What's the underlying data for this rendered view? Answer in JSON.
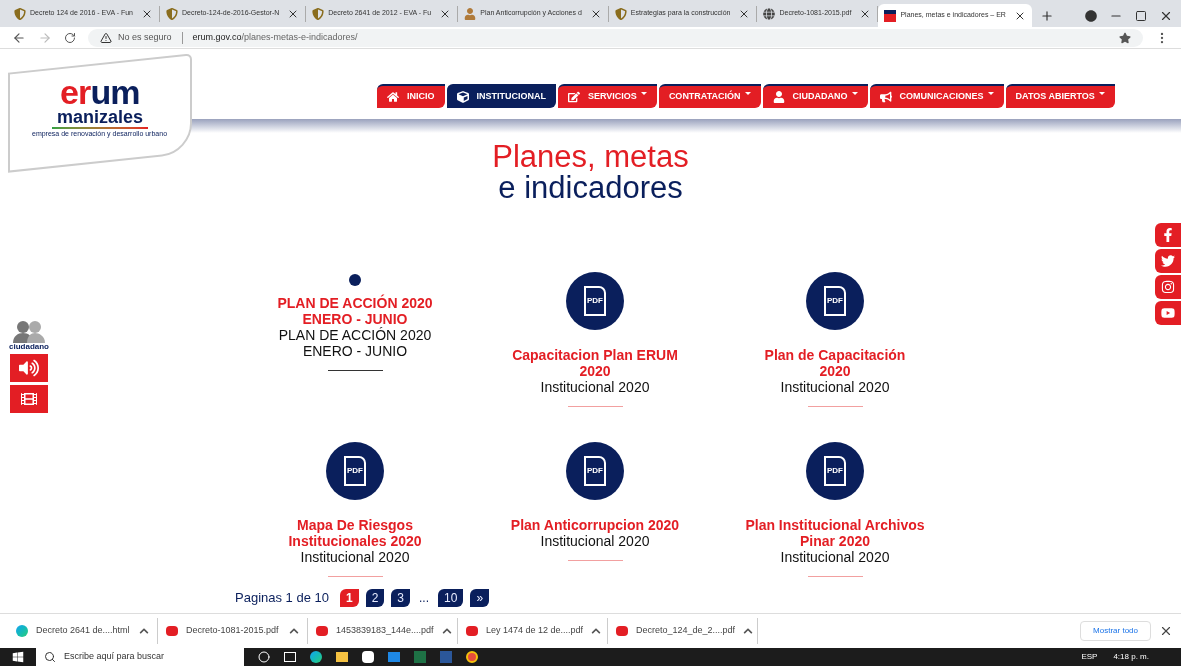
{
  "browser": {
    "tabs": [
      {
        "title": "Decreto 124 de 2016 - EVA - Fun",
        "selected": false
      },
      {
        "title": "Decreto-124-de-2016-Gestor-N",
        "selected": false
      },
      {
        "title": "Decreto 2641 de 2012 - EVA - Fu",
        "selected": false
      },
      {
        "title": "Plan Anticorrupción y Acciones d",
        "selected": false
      },
      {
        "title": "Estrategias para la construcción",
        "selected": false
      },
      {
        "title": "Decreto-1081-2015.pdf",
        "selected": false
      },
      {
        "title": "Planes, metas e indicadores – ER",
        "selected": true
      }
    ],
    "security": "No es seguro",
    "url_host": "erum.gov.co",
    "url_path": "/planes-metas-e-indicadores/"
  },
  "logo": {
    "brand_a": "er",
    "brand_b": "um",
    "city": "manizales",
    "tagline": "empresa de renovación y desarrollo urbano"
  },
  "menu": [
    {
      "label": "INICIO",
      "selected": false,
      "dropdown": false
    },
    {
      "label": "INSTITUCIONAL",
      "selected": true,
      "dropdown": false
    },
    {
      "label": "SERVICIOS",
      "selected": false,
      "dropdown": true
    },
    {
      "label": "CONTRATACIÓN",
      "selected": false,
      "dropdown": true
    },
    {
      "label": "CIUDADANO",
      "selected": false,
      "dropdown": true
    },
    {
      "label": "COMUNICACIONES",
      "selected": false,
      "dropdown": true
    },
    {
      "label": "DATOS ABIERTOS",
      "selected": false,
      "dropdown": true
    }
  ],
  "page_title": {
    "line_1": "Planes, metas",
    "line_2": "e indicadores"
  },
  "accessibility": {
    "label": "ciudadano"
  },
  "cards": [
    {
      "kind": "bullet",
      "title_lines": [
        "PLAN DE ACCIÓN 2020",
        "ENERO - JUNIO"
      ],
      "subtitle_lines": [
        "PLAN DE ACCIÓN 2020",
        "ENERO - JUNIO"
      ]
    },
    {
      "kind": "pdf",
      "icon_label": "PDF",
      "title_lines": [
        "Capacitacion Plan ERUM",
        "2020"
      ],
      "subtitle_lines": [
        "Institucional 2020"
      ]
    },
    {
      "kind": "pdf",
      "icon_label": "PDF",
      "title_lines": [
        "Plan de Capacitación",
        "2020"
      ],
      "subtitle_lines": [
        "Institucional 2020"
      ]
    },
    {
      "kind": "pdf",
      "icon_label": "PDF",
      "title_lines": [
        "Mapa De Riesgos",
        "Institucionales 2020"
      ],
      "subtitle_lines": [
        "Institucional 2020"
      ]
    },
    {
      "kind": "pdf",
      "icon_label": "PDF",
      "title_lines": [
        "Plan Anticorrupcion 2020"
      ],
      "subtitle_lines": [
        "Institucional 2020"
      ]
    },
    {
      "kind": "pdf",
      "icon_label": "PDF",
      "title_lines": [
        "Plan Institucional Archivos",
        "Pinar 2020"
      ],
      "subtitle_lines": [
        "Institucional 2020"
      ]
    }
  ],
  "pagination": {
    "summary": "Paginas 1 de 10",
    "pages": [
      {
        "label": "1",
        "kind": "page",
        "selected": true
      },
      {
        "label": "2",
        "kind": "page",
        "selected": false
      },
      {
        "label": "3",
        "kind": "page",
        "selected": false
      },
      {
        "label": "...",
        "kind": "gap"
      },
      {
        "label": "10",
        "kind": "page",
        "selected": false
      },
      {
        "label": "»",
        "kind": "page",
        "selected": false
      }
    ]
  },
  "downloads": {
    "items": [
      {
        "name": "Decreto 2641 de....html",
        "kind": "html"
      },
      {
        "name": "Decreto-1081-2015.pdf",
        "kind": "pdf"
      },
      {
        "name": "1453839183_144e....pdf",
        "kind": "pdf"
      },
      {
        "name": "Ley 1474 de 12 de....pdf",
        "kind": "pdf"
      },
      {
        "name": "Decreto_124_de_2....pdf",
        "kind": "pdf"
      }
    ],
    "show_all": "Mostrar todo"
  },
  "taskbar": {
    "search_placeholder": "Escribe aquí para buscar",
    "language": "ESP",
    "time": "4:18 p. m."
  }
}
